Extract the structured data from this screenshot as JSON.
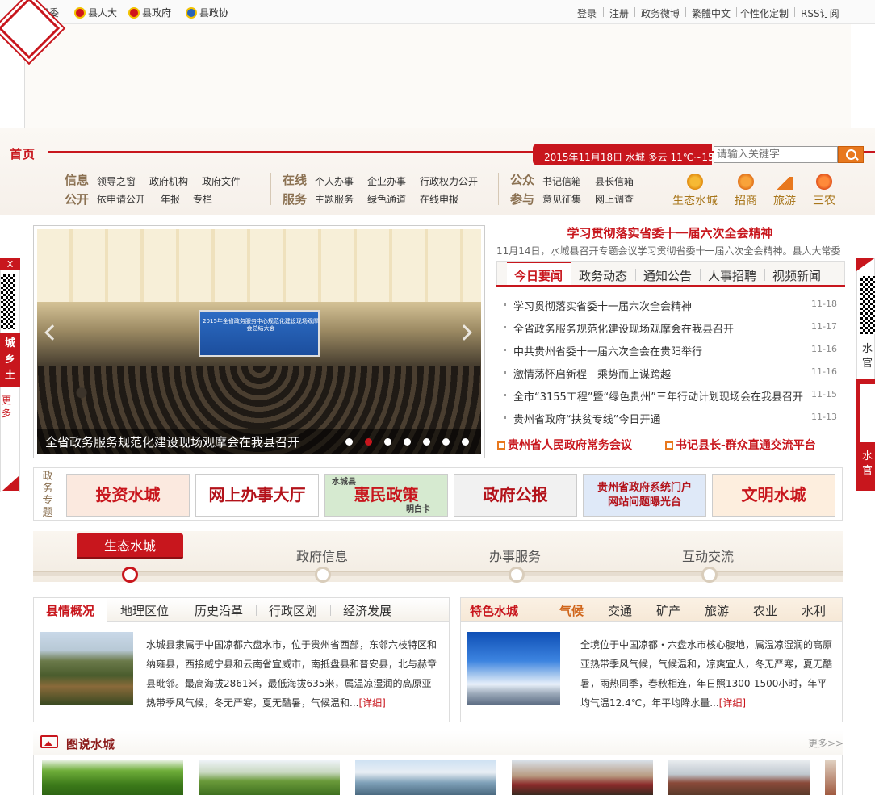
{
  "topbar": {
    "left_links": [
      "县委",
      "县人大",
      "县政府",
      "县政协"
    ],
    "right_links": [
      "登录",
      "注册",
      "政务微博",
      "繁體中文",
      "个性化定制",
      "RSS订阅"
    ]
  },
  "nav": {
    "home": "首页",
    "date_weather": "2015年11月18日  水城  多云  11℃~15℃",
    "search_placeholder": "请输入关键字",
    "groups": [
      {
        "title1": "信息",
        "title2": "公开",
        "row1": [
          "领导之窗",
          "政府机构",
          "政府文件"
        ],
        "row2": [
          "依申请公开",
          "年报",
          "专栏"
        ]
      },
      {
        "title1": "在线",
        "title2": "服务",
        "row1": [
          "个人办事",
          "企业办事",
          "行政权力公开"
        ],
        "row2": [
          "主题服务",
          "绿色通道",
          "在线申报"
        ]
      },
      {
        "title1": "公众",
        "title2": "参与",
        "row1": [
          "书记信箱",
          "县长信箱"
        ],
        "row2": [
          "意见征集",
          "网上调查"
        ]
      }
    ],
    "quick_links": [
      "生态水城",
      "招商",
      "旅游",
      "三农"
    ]
  },
  "side_left": {
    "close": "X",
    "text": "城乡土",
    "lower": "更多"
  },
  "side_right": {
    "text1": "水官",
    "text2": "水官"
  },
  "slider": {
    "screen_title": "2015年全省政务服务中心规范化建设现场观摩会总结大会",
    "caption": "全省政务服务规范化建设现场观摩会在我县召开",
    "dots": 7,
    "active_dot": 2
  },
  "news": {
    "headline": "学习贯彻落实省委十一届六次全会精神",
    "summary": "11月14日，水城县召开专题会议学习贯彻省委十一届六次全会精神。县人大常委",
    "tabs": [
      "今日要闻",
      "政务动态",
      "通知公告",
      "人事招聘",
      "视频新闻"
    ],
    "active_tab": "今日要闻",
    "items": [
      {
        "title": "学习贯彻落实省委十一届六次全会精神",
        "date": "11-18"
      },
      {
        "title": "全省政务服务规范化建设现场观摩会在我县召开",
        "date": "11-17"
      },
      {
        "title": "中共贵州省委十一届六次全会在贵阳举行",
        "date": "11-16"
      },
      {
        "title": "激情荡怀启新程　乘势而上谋跨越",
        "date": "11-16"
      },
      {
        "title": "全市“3155工程”暨“绿色贵州”三年行动计划现场会在我县召开",
        "date": "11-15"
      },
      {
        "title": "贵州省政府“扶贫专线”今日开通",
        "date": "11-13"
      }
    ],
    "promo_links": [
      "贵州省人民政府常务会议",
      "书记县长-群众直通交流平台"
    ]
  },
  "topics": {
    "label": "政务专题",
    "items": [
      {
        "text": "投资水城",
        "color": "#c8161d",
        "bg": "#fbe9df"
      },
      {
        "text": "网上办事大厅",
        "color": "#b3121a",
        "bg": "#fff"
      },
      {
        "text": "惠民政策",
        "color": "#c8161d",
        "bg": "#d6ead0",
        "tag": "水城县",
        "sub": "明白卡"
      },
      {
        "text": "政府公报",
        "color": "#b3121a",
        "bg": "#f1f1f1"
      },
      {
        "text": "贵州省政府系统门户网站问题曝光台",
        "color": "#b3121a",
        "bg": "#dfe9f8"
      },
      {
        "text": "文明水城",
        "color": "#c8161d",
        "bg": "#fdeede"
      }
    ]
  },
  "timeline": {
    "items": [
      "生态水城",
      "政府信息",
      "办事服务",
      "互动交流"
    ],
    "active": "生态水城"
  },
  "county": {
    "tabs": [
      "县情概况",
      "地理区位",
      "历史沿革",
      "行政区划",
      "经济发展"
    ],
    "active_tab": "县情概况",
    "text": "水城县隶属于中国凉都六盘水市，位于贵州省西部，东邻六枝特区和纳雍县，西接威宁县和云南省宣威市，南抵盘县和普安县，北与赫章县毗邻。最高海拔2861米，最低海拔635米，属温凉湿润的高原亚热带季风气候，冬无严寒，夏无酷暑，气候温和...",
    "more": "[详细]"
  },
  "feature": {
    "title": "特色水城",
    "tabs": [
      "气候",
      "交通",
      "矿产",
      "旅游",
      "农业",
      "水利"
    ],
    "active_tab": "气候",
    "text": "全境位于中国凉都・六盘水市核心腹地，属温凉湿润的高原亚热带季风气候，气候温和，凉爽宜人，冬无严寒，夏无酷暑，雨热同季，春秋相连，年日照1300-1500小时，年平均气温12.4℃，年平均降水量...",
    "more": "[详细]"
  },
  "gallery": {
    "title": "图说水城",
    "more": "更多>>"
  },
  "colors": {
    "accent": "#c8161d",
    "gold": "#a8761b",
    "brown": "#8b7152"
  }
}
